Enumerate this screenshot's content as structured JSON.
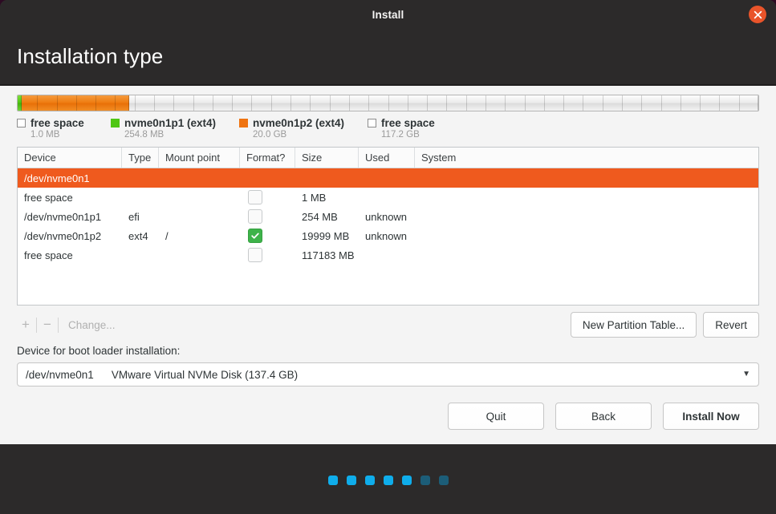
{
  "window": {
    "title": "Install",
    "close_icon": "close-icon"
  },
  "page": {
    "title": "Installation type"
  },
  "partition_bar": {
    "segments": [
      {
        "name": "nvme0n1p1",
        "color": "#4fc614",
        "kind": "green",
        "width_pct": 0.55
      },
      {
        "name": "nvme0n1p2",
        "color": "#ef7310",
        "kind": "orange",
        "width_pct": 14.5
      },
      {
        "name": "free space",
        "color": "#ececec",
        "kind": "free",
        "width_pct": 84.95
      }
    ]
  },
  "legend": [
    {
      "swatch": "empty",
      "label": "free space",
      "size": "1.0 MB"
    },
    {
      "swatch": "green",
      "label": "nvme0n1p1 (ext4)",
      "size": "254.8 MB"
    },
    {
      "swatch": "orange",
      "label": "nvme0n1p2 (ext4)",
      "size": "20.0 GB"
    },
    {
      "swatch": "empty",
      "label": "free space",
      "size": "117.2 GB"
    }
  ],
  "table": {
    "columns": [
      "Device",
      "Type",
      "Mount point",
      "Format?",
      "Size",
      "Used",
      "System"
    ],
    "rows": [
      {
        "selected": true,
        "device": "/dev/nvme0n1",
        "type": "",
        "mount": "",
        "format": null,
        "size": "",
        "used": "",
        "system": ""
      },
      {
        "selected": false,
        "device": "free space",
        "type": "",
        "mount": "",
        "format": false,
        "size": "1 MB",
        "used": "",
        "system": ""
      },
      {
        "selected": false,
        "device": "/dev/nvme0n1p1",
        "type": "efi",
        "mount": "",
        "format": false,
        "size": "254 MB",
        "used": "unknown",
        "system": ""
      },
      {
        "selected": false,
        "device": "/dev/nvme0n1p2",
        "type": "ext4",
        "mount": "/",
        "format": true,
        "size": "19999 MB",
        "used": "unknown",
        "system": ""
      },
      {
        "selected": false,
        "device": "free space",
        "type": "",
        "mount": "",
        "format": false,
        "size": "117183 MB",
        "used": "",
        "system": ""
      }
    ]
  },
  "table_actions": {
    "add_label": "+",
    "remove_label": "−",
    "change_label": "Change...",
    "new_partition_table_label": "New Partition Table...",
    "revert_label": "Revert"
  },
  "bootloader": {
    "label": "Device for boot loader installation:",
    "selected_device": "/dev/nvme0n1",
    "selected_description": "VMware Virtual NVMe Disk (137.4 GB)",
    "arrow_icon": "chevron-down-icon"
  },
  "nav": {
    "quit_label": "Quit",
    "back_label": "Back",
    "install_label": "Install Now"
  },
  "progress": {
    "total_dots": 7,
    "active_dots": 5,
    "active_color": "#0fadeb",
    "inactive_color": "#1c5d78"
  }
}
